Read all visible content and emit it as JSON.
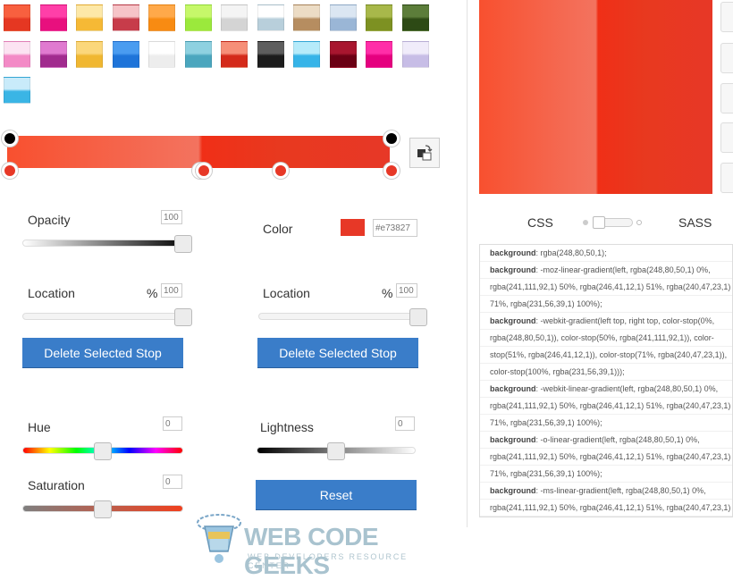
{
  "presets": [
    {
      "row": 0,
      "col": 0,
      "colors": [
        "#f8603f",
        "#e53722"
      ]
    },
    {
      "row": 0,
      "col": 1,
      "colors": [
        "#ff3fa8",
        "#e8107e"
      ]
    },
    {
      "row": 0,
      "col": 2,
      "colors": [
        "#fde8a8",
        "#f6b935"
      ]
    },
    {
      "row": 0,
      "col": 3,
      "colors": [
        "#f6c4c8",
        "#c73c4a"
      ]
    },
    {
      "row": 0,
      "col": 4,
      "colors": [
        "#ffa94a",
        "#f88b12"
      ]
    },
    {
      "row": 0,
      "col": 5,
      "colors": [
        "#c6f86a",
        "#9be93c"
      ]
    },
    {
      "row": 0,
      "col": 6,
      "colors": [
        "#f4f4f4",
        "#d4d4d4"
      ]
    },
    {
      "row": 0,
      "col": 7,
      "colors": [
        "#ffffff",
        "#b8cfdb"
      ]
    },
    {
      "row": 0,
      "col": 8,
      "colors": [
        "#ecdcc5",
        "#b68d60"
      ]
    },
    {
      "row": 0,
      "col": 9,
      "colors": [
        "#dbe6f2",
        "#9ab6d6"
      ]
    },
    {
      "row": 0,
      "col": 10,
      "colors": [
        "#a8b84a",
        "#7d9122"
      ]
    },
    {
      "row": 0,
      "col": 11,
      "colors": [
        "#5c7d3a",
        "#2d4a15"
      ]
    },
    {
      "row": 1,
      "col": 0,
      "colors": [
        "#fce3f2",
        "#f38ac6"
      ]
    },
    {
      "row": 1,
      "col": 1,
      "colors": [
        "#e07ad0",
        "#a12b8e"
      ]
    },
    {
      "row": 1,
      "col": 2,
      "colors": [
        "#fbd77b",
        "#f0b731"
      ]
    },
    {
      "row": 1,
      "col": 3,
      "colors": [
        "#4a9cf0",
        "#1e74d9"
      ]
    },
    {
      "row": 1,
      "col": 4,
      "colors": [
        "#ffffff",
        "#ededed"
      ]
    },
    {
      "row": 1,
      "col": 5,
      "colors": [
        "#8ed1e0",
        "#4aa6be"
      ]
    },
    {
      "row": 1,
      "col": 6,
      "colors": [
        "#f68f78",
        "#d42a1a"
      ]
    },
    {
      "row": 1,
      "col": 7,
      "colors": [
        "#5e5e5e",
        "#1c1c1c"
      ]
    },
    {
      "row": 1,
      "col": 8,
      "colors": [
        "#b6ebfa",
        "#36b4e8"
      ]
    },
    {
      "row": 1,
      "col": 9,
      "colors": [
        "#a8162f",
        "#6b0014"
      ]
    },
    {
      "row": 1,
      "col": 10,
      "colors": [
        "#ff2ea8",
        "#e5007f"
      ]
    },
    {
      "row": 1,
      "col": 11,
      "colors": [
        "#f0ecfa",
        "#c7bde6"
      ]
    },
    {
      "row": 2,
      "col": 0,
      "colors": [
        "#c9ebfa",
        "#3ab5e5"
      ]
    }
  ],
  "opacity": {
    "label": "Opacity",
    "value": "100"
  },
  "color": {
    "label": "Color",
    "hex": "#e73827",
    "swatch": "#e73827"
  },
  "location_left": {
    "label": "Location",
    "unit": "%",
    "value": "100"
  },
  "location_right": {
    "label": "Location",
    "unit": "%",
    "value": "100"
  },
  "delete_left": "Delete Selected Stop",
  "delete_right": "Delete Selected Stop",
  "hue": {
    "label": "Hue",
    "value": "0"
  },
  "lightness": {
    "label": "Lightness",
    "value": "0"
  },
  "saturation": {
    "label": "Saturation",
    "value": "0"
  },
  "reset": "Reset",
  "toggle": {
    "left": "CSS",
    "right": "SASS"
  },
  "code_lines": [
    {
      "k": "background",
      "v": ": rgba(248,80,50,1);"
    },
    {
      "k": "background",
      "v": ": -moz-linear-gradient(left, rgba(248,80,50,1) 0%,"
    },
    {
      "k": "",
      "v": "rgba(241,111,92,1) 50%, rgba(246,41,12,1) 51%, rgba(240,47,23,1)"
    },
    {
      "k": "",
      "v": "71%, rgba(231,56,39,1) 100%);"
    },
    {
      "k": "background",
      "v": ": -webkit-gradient(left top, right top, color-stop(0%,"
    },
    {
      "k": "",
      "v": "rgba(248,80,50,1)), color-stop(50%, rgba(241,111,92,1)), color-"
    },
    {
      "k": "",
      "v": "stop(51%, rgba(246,41,12,1)), color-stop(71%, rgba(240,47,23,1)),"
    },
    {
      "k": "",
      "v": "color-stop(100%, rgba(231,56,39,1)));"
    },
    {
      "k": "background",
      "v": ": -webkit-linear-gradient(left, rgba(248,80,50,1) 0%,"
    },
    {
      "k": "",
      "v": "rgba(241,111,92,1) 50%, rgba(246,41,12,1) 51%, rgba(240,47,23,1)"
    },
    {
      "k": "",
      "v": "71%, rgba(231,56,39,1) 100%);"
    },
    {
      "k": "background",
      "v": ": -o-linear-gradient(left, rgba(248,80,50,1) 0%,"
    },
    {
      "k": "",
      "v": "rgba(241,111,92,1) 50%, rgba(246,41,12,1) 51%, rgba(240,47,23,1)"
    },
    {
      "k": "",
      "v": "71%, rgba(231,56,39,1) 100%);"
    },
    {
      "k": "background",
      "v": ": -ms-linear-gradient(left, rgba(248,80,50,1) 0%,"
    },
    {
      "k": "",
      "v": "rgba(241,111,92,1) 50%, rgba(246,41,12,1) 51%, rgba(240,47,23,1)"
    },
    {
      "k": "",
      "v": "71%, rgba(231,56,39,1) 100%);"
    }
  ],
  "watermark": {
    "title": "WEB CODE GEEKS",
    "subtitle": "WEB DEVELOPERS RESOURCE CENTER"
  }
}
